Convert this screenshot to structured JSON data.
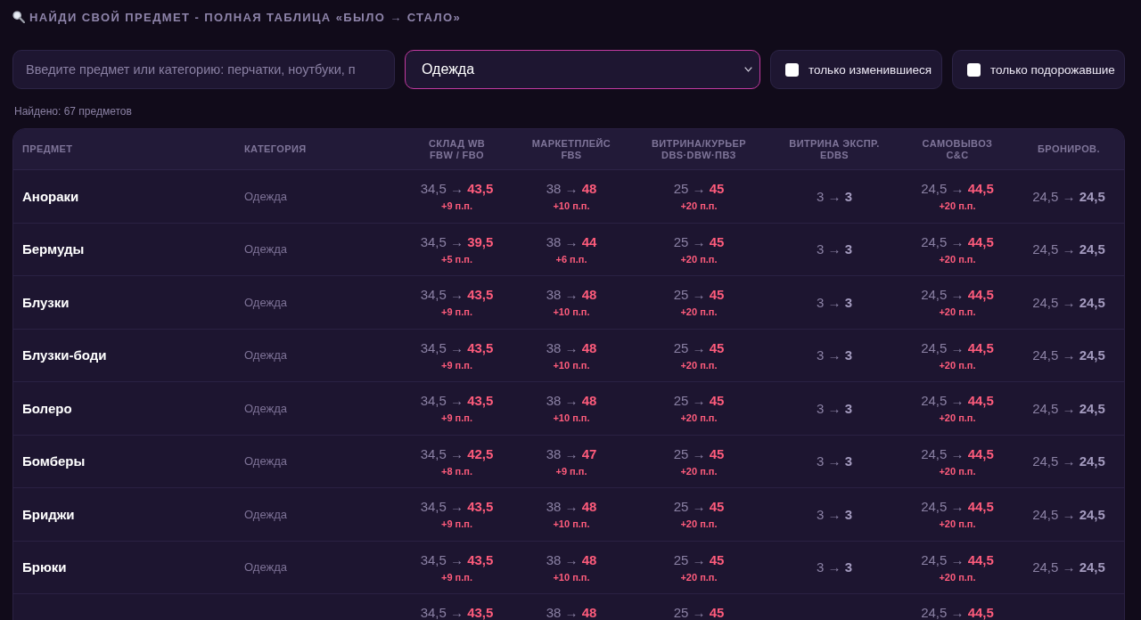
{
  "title": "НАЙДИ СВОЙ ПРЕДМЕТ - ПОЛНАЯ ТАБЛИЦА «БЫЛО → СТАЛО»",
  "search": {
    "placeholder": "Введите предмет или категорию: перчатки, ноутбуки, п"
  },
  "category_filter": {
    "value": "Одежда",
    "active": true
  },
  "filters": [
    {
      "label": "только изменившиеся",
      "checked": false
    },
    {
      "label": "только подорожавшие",
      "checked": false
    }
  ],
  "found": "Найдено: 67 предметов",
  "table": {
    "columns": [
      {
        "label": "ПРЕДМЕТ"
      },
      {
        "label": "КАТЕГОРИЯ"
      },
      {
        "label": "СКЛАД WB",
        "sublabel": "FBW / FBO"
      },
      {
        "label": "МАРКЕТПЛЕЙС",
        "sublabel": "FBS"
      },
      {
        "label": "ВИТРИНА/КУРЬЕР",
        "sublabel": "DBS·DBW·ПВЗ"
      },
      {
        "label": "ВИТРИНА ЭКСПР.",
        "sublabel": "EDBS"
      },
      {
        "label": "САМОВЫВОЗ",
        "sublabel": "C&C"
      },
      {
        "label": "БРОНИРОВ."
      }
    ],
    "rows": [
      {
        "name": "Анораки",
        "category": "Одежда",
        "rates": [
          {
            "kind": "increase",
            "value": "34,5 → **43,5**",
            "change": "+9 п.п."
          },
          {
            "kind": "increase",
            "value": "38 → **48**",
            "change": "+10 п.п."
          },
          {
            "kind": "increase",
            "value": "25 → **45**",
            "change": "+20 п.п."
          },
          {
            "kind": "unchanged",
            "value": "3 → **3**"
          },
          {
            "kind": "increase",
            "value": "24,5 → **44,5**",
            "change": "+20 п.п."
          },
          {
            "kind": "unchanged",
            "value": "24,5 → **24,5**"
          }
        ]
      },
      {
        "name": "Бермуды",
        "category": "Одежда",
        "rates": [
          {
            "kind": "increase",
            "value": "34,5 → **39,5**",
            "change": "+5 п.п."
          },
          {
            "kind": "increase",
            "value": "38 → **44**",
            "change": "+6 п.п."
          },
          {
            "kind": "increase",
            "value": "25 → **45**",
            "change": "+20 п.п."
          },
          {
            "kind": "unchanged",
            "value": "3 → **3**"
          },
          {
            "kind": "increase",
            "value": "24,5 → **44,5**",
            "change": "+20 п.п."
          },
          {
            "kind": "unchanged",
            "value": "24,5 → **24,5**"
          }
        ]
      },
      {
        "name": "Блузки",
        "category": "Одежда",
        "rates": [
          {
            "kind": "increase",
            "value": "34,5 → **43,5**",
            "change": "+9 п.п."
          },
          {
            "kind": "increase",
            "value": "38 → **48**",
            "change": "+10 п.п."
          },
          {
            "kind": "increase",
            "value": "25 → **45**",
            "change": "+20 п.п."
          },
          {
            "kind": "unchanged",
            "value": "3 → **3**"
          },
          {
            "kind": "increase",
            "value": "24,5 → **44,5**",
            "change": "+20 п.п."
          },
          {
            "kind": "unchanged",
            "value": "24,5 → **24,5**"
          }
        ]
      },
      {
        "name": "Блузки-боди",
        "category": "Одежда",
        "rates": [
          {
            "kind": "increase",
            "value": "34,5 → **43,5**",
            "change": "+9 п.п."
          },
          {
            "kind": "increase",
            "value": "38 → **48**",
            "change": "+10 п.п."
          },
          {
            "kind": "increase",
            "value": "25 → **45**",
            "change": "+20 п.п."
          },
          {
            "kind": "unchanged",
            "value": "3 → **3**"
          },
          {
            "kind": "increase",
            "value": "24,5 → **44,5**",
            "change": "+20 п.п."
          },
          {
            "kind": "unchanged",
            "value": "24,5 → **24,5**"
          }
        ]
      },
      {
        "name": "Болеро",
        "category": "Одежда",
        "rates": [
          {
            "kind": "increase",
            "value": "34,5 → **43,5**",
            "change": "+9 п.п."
          },
          {
            "kind": "increase",
            "value": "38 → **48**",
            "change": "+10 п.п."
          },
          {
            "kind": "increase",
            "value": "25 → **45**",
            "change": "+20 п.п."
          },
          {
            "kind": "unchanged",
            "value": "3 → **3**"
          },
          {
            "kind": "increase",
            "value": "24,5 → **44,5**",
            "change": "+20 п.п."
          },
          {
            "kind": "unchanged",
            "value": "24,5 → **24,5**"
          }
        ]
      },
      {
        "name": "Бомберы",
        "category": "Одежда",
        "rates": [
          {
            "kind": "increase",
            "value": "34,5 → **42,5**",
            "change": "+8 п.п."
          },
          {
            "kind": "increase",
            "value": "38 → **47**",
            "change": "+9 п.п."
          },
          {
            "kind": "increase",
            "value": "25 → **45**",
            "change": "+20 п.п."
          },
          {
            "kind": "unchanged",
            "value": "3 → **3**"
          },
          {
            "kind": "increase",
            "value": "24,5 → **44,5**",
            "change": "+20 п.п."
          },
          {
            "kind": "unchanged",
            "value": "24,5 → **24,5**"
          }
        ]
      },
      {
        "name": "Бриджи",
        "category": "Одежда",
        "rates": [
          {
            "kind": "increase",
            "value": "34,5 → **43,5**",
            "change": "+9 п.п."
          },
          {
            "kind": "increase",
            "value": "38 → **48**",
            "change": "+10 п.п."
          },
          {
            "kind": "increase",
            "value": "25 → **45**",
            "change": "+20 п.п."
          },
          {
            "kind": "unchanged",
            "value": "3 → **3**"
          },
          {
            "kind": "increase",
            "value": "24,5 → **44,5**",
            "change": "+20 п.п."
          },
          {
            "kind": "unchanged",
            "value": "24,5 → **24,5**"
          }
        ]
      },
      {
        "name": "Брюки",
        "category": "Одежда",
        "rates": [
          {
            "kind": "increase",
            "value": "34,5 → **43,5**",
            "change": "+9 п.п."
          },
          {
            "kind": "increase",
            "value": "38 → **48**",
            "change": "+10 п.п."
          },
          {
            "kind": "increase",
            "value": "25 → **45**",
            "change": "+20 п.п."
          },
          {
            "kind": "unchanged",
            "value": "3 → **3**"
          },
          {
            "kind": "increase",
            "value": "24,5 → **44,5**",
            "change": "+20 п.п."
          },
          {
            "kind": "unchanged",
            "value": "24,5 → **24,5**"
          }
        ]
      },
      {
        "rates": [
          {
            "kind": "increase",
            "value": "34,5 → **43,5**"
          },
          {
            "kind": "increase",
            "value": "38 → **48**"
          },
          {
            "kind": "increase",
            "value": "25 → **45**"
          },
          {
            "kind": "unchanged"
          },
          {
            "kind": "increase",
            "value": "24,5 → **44,5**"
          },
          {
            "kind": "unchanged"
          }
        ]
      }
    ]
  }
}
